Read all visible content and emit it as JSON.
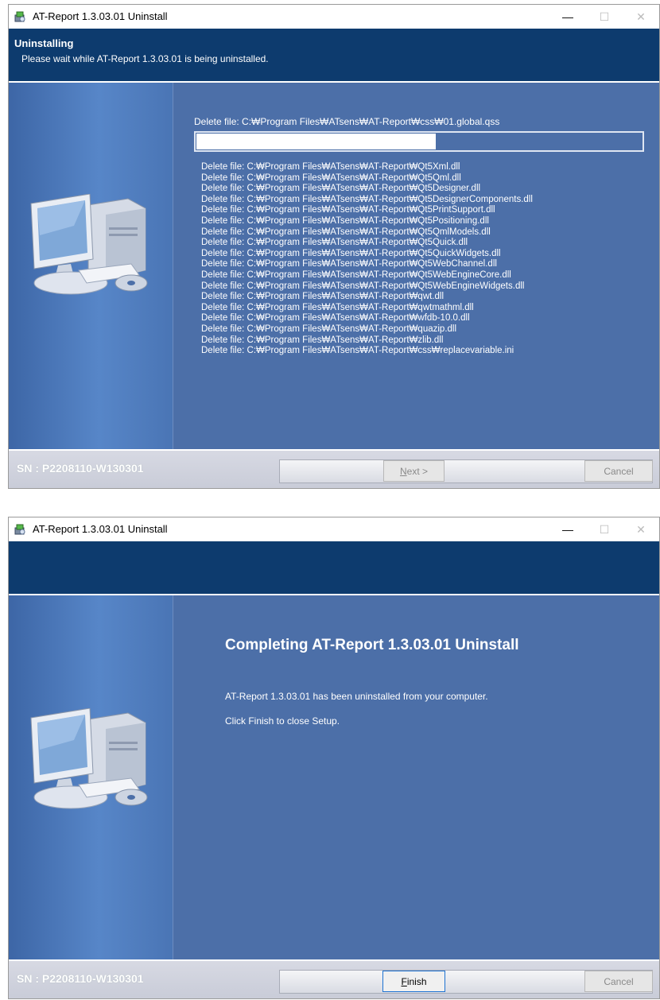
{
  "windows": [
    {
      "title": "AT-Report 1.3.03.01 Uninstall",
      "minimize": "—",
      "maximize": "☐",
      "close": "✕",
      "header": {
        "title": "Uninstalling",
        "subtitle": "Please wait while AT-Report 1.3.03.01 is being uninstalled."
      },
      "current_file": "Delete file: C:₩Program Files₩ATsens₩AT-Report₩css₩01.global.qss",
      "progress": 0.54,
      "log": [
        "Delete file: C:₩Program Files₩ATsens₩AT-Report₩Qt5Xml.dll",
        "Delete file: C:₩Program Files₩ATsens₩AT-Report₩Qt5Qml.dll",
        "Delete file: C:₩Program Files₩ATsens₩AT-Report₩Qt5Designer.dll",
        "Delete file: C:₩Program Files₩ATsens₩AT-Report₩Qt5DesignerComponents.dll",
        "Delete file: C:₩Program Files₩ATsens₩AT-Report₩Qt5PrintSupport.dll",
        "Delete file: C:₩Program Files₩ATsens₩AT-Report₩Qt5Positioning.dll",
        "Delete file: C:₩Program Files₩ATsens₩AT-Report₩Qt5QmlModels.dll",
        "Delete file: C:₩Program Files₩ATsens₩AT-Report₩Qt5Quick.dll",
        "Delete file: C:₩Program Files₩ATsens₩AT-Report₩Qt5QuickWidgets.dll",
        "Delete file: C:₩Program Files₩ATsens₩AT-Report₩Qt5WebChannel.dll",
        "Delete file: C:₩Program Files₩ATsens₩AT-Report₩Qt5WebEngineCore.dll",
        "Delete file: C:₩Program Files₩ATsens₩AT-Report₩Qt5WebEngineWidgets.dll",
        "Delete file: C:₩Program Files₩ATsens₩AT-Report₩qwt.dll",
        "Delete file: C:₩Program Files₩ATsens₩AT-Report₩qwtmathml.dll",
        "Delete file: C:₩Program Files₩ATsens₩AT-Report₩wfdb-10.0.dll",
        "Delete file: C:₩Program Files₩ATsens₩AT-Report₩quazip.dll",
        "Delete file: C:₩Program Files₩ATsens₩AT-Report₩zlib.dll",
        "Delete file: C:₩Program Files₩ATsens₩AT-Report₩css₩replacevariable.ini"
      ],
      "footer": {
        "sn": "SN : P2208110-W130301",
        "next_prefix": "N",
        "next_rest": "ext >",
        "cancel": "Cancel"
      }
    },
    {
      "title": "AT-Report 1.3.03.01 Uninstall",
      "minimize": "—",
      "maximize": "☐",
      "close": "✕",
      "complete": {
        "title": "Completing AT-Report 1.3.03.01 Uninstall",
        "message": "AT-Report 1.3.03.01 has been uninstalled from your computer.",
        "hint": "Click Finish to close Setup."
      },
      "footer": {
        "sn": "SN : P2208110-W130301",
        "finish_prefix": "F",
        "finish_rest": "inish",
        "cancel": "Cancel"
      }
    }
  ],
  "icons": {
    "app": "installer-icon",
    "sidebar": "computer-cd-icon"
  },
  "colors": {
    "header_bg": "#0d3b6e",
    "content_bg": "#4c6fa8",
    "footer_bg": "#d0d3de"
  }
}
